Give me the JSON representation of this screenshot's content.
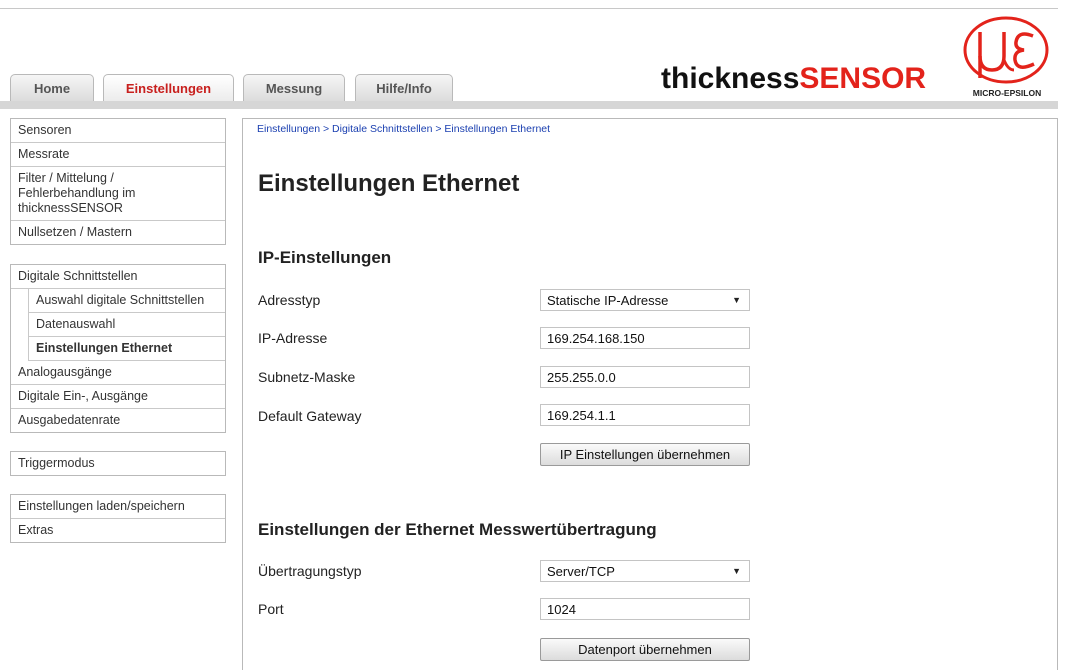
{
  "tabs": [
    {
      "label": "Home"
    },
    {
      "label": "Einstellungen"
    },
    {
      "label": "Messung"
    },
    {
      "label": "Hilfe/Info"
    }
  ],
  "brand": {
    "part1": "thickness",
    "part2": "SENSOR",
    "logo_text": "MICRO-EPSILON",
    "accent_color": "#e3231b"
  },
  "sidebar": {
    "group1": [
      "Sensoren",
      "Messrate",
      "Filter / Mittelung / Fehlerbehandlung im thicknessSENSOR",
      "Nullsetzen / Mastern"
    ],
    "group2": [
      "Digitale Schnittstellen",
      "Auswahl digitale Schnittstellen",
      "Datenauswahl",
      "Einstellungen Ethernet",
      "Analogausgänge",
      "Digitale Ein-, Ausgänge",
      "Ausgabedatenrate"
    ],
    "group3": [
      "Triggermodus"
    ],
    "group4": [
      "Einstellungen laden/speichern",
      "Extras"
    ]
  },
  "breadcrumb": {
    "item1": "Einstellungen",
    "item2": "Digitale Schnittstellen",
    "item3": "Einstellungen Ethernet",
    "separator": ">"
  },
  "page_title": "Einstellungen Ethernet",
  "ip_section": {
    "title": "IP-Einstellungen",
    "adresstyp_label": "Adresstyp",
    "adresstyp_value": "Statische IP-Adresse",
    "ip_label": "IP-Adresse",
    "ip_value": "169.254.168.150",
    "subnet_label": "Subnetz-Maske",
    "subnet_value": "255.255.0.0",
    "gateway_label": "Default Gateway",
    "gateway_value": "169.254.1.1",
    "apply_label": "IP Einstellungen übernehmen"
  },
  "transfer_section": {
    "title": "Einstellungen der Ethernet Messwertübertragung",
    "type_label": "Übertragungstyp",
    "type_value": "Server/TCP",
    "port_label": "Port",
    "port_value": "1024",
    "apply_label": "Datenport übernehmen"
  }
}
